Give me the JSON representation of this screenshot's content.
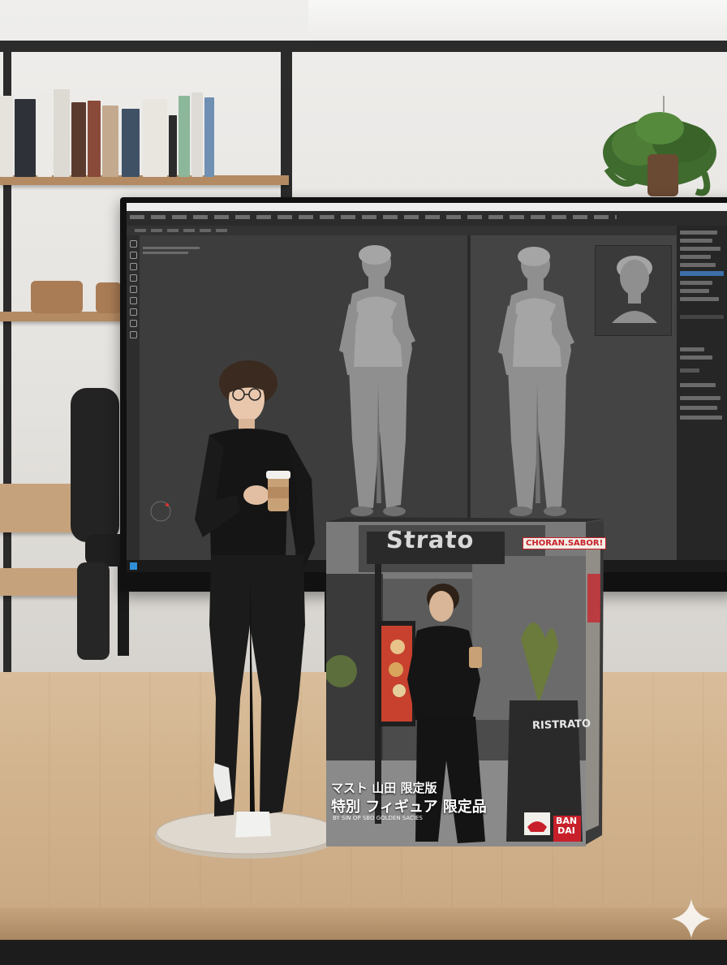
{
  "scene": {
    "description_tags": [
      "desk",
      "monitor",
      "figure",
      "box"
    ]
  },
  "box": {
    "cafe_sign": "Strato",
    "small_sign": "CHORAN.SABOR!",
    "aframe_sign": "RISTRATO",
    "jp_line_1": "マスト 山田 限定版",
    "jp_line_2": "特別 フィギュア 限定品",
    "small_caption": "BY SIN OP SBO GOLDEN SACIES",
    "brand_logo": "BAN DAI"
  },
  "colors": {
    "screen_bg": "#3a3a3a",
    "clay": "#8f8f8f",
    "desk": "#d2b48e",
    "box_red": "#c8202a"
  },
  "icons": [
    "sparkle-icon",
    "windows-start-icon",
    "sculpt-brush-icon"
  ]
}
